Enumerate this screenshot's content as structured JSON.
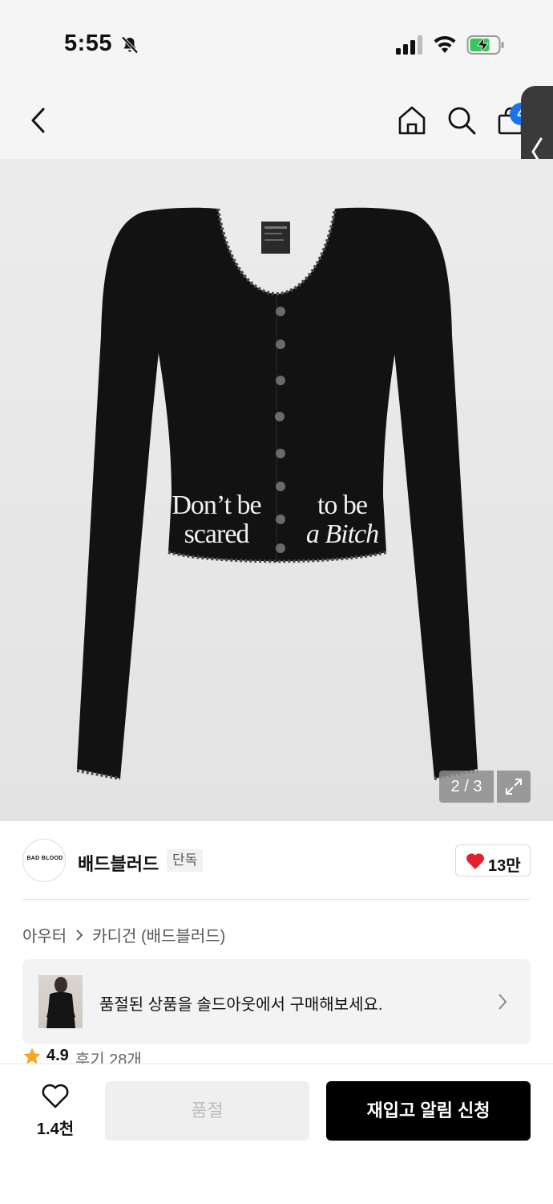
{
  "status_bar": {
    "time": "5:55"
  },
  "nav": {
    "cart_count": "4"
  },
  "product_image": {
    "slogan_left_line1": "Don’t be",
    "slogan_left_line2": "scared",
    "slogan_right_line1": "to be",
    "slogan_right_line2": "a Bitch",
    "page_indicator": "2 / 3"
  },
  "brand": {
    "logo_text": "BAD BLOOD",
    "name": "배드블러드",
    "badge": "단독",
    "like_count": "13만"
  },
  "breadcrumb": {
    "category": "아우터",
    "subcategory": "카디건 (배드블러드)"
  },
  "soldout_banner": {
    "text": "품절된 상품을 솔드아웃에서 구매해보세요."
  },
  "rating": {
    "score": "4.9",
    "reviews": "후기 28개"
  },
  "bottom_bar": {
    "wish_count": "1.4천",
    "soldout_label": "품절",
    "restock_label": "재입고 알림 신청"
  },
  "colors": {
    "accent_blue": "#1a73e8",
    "heart_red": "#e5202e",
    "star_orange": "#f5a623"
  }
}
